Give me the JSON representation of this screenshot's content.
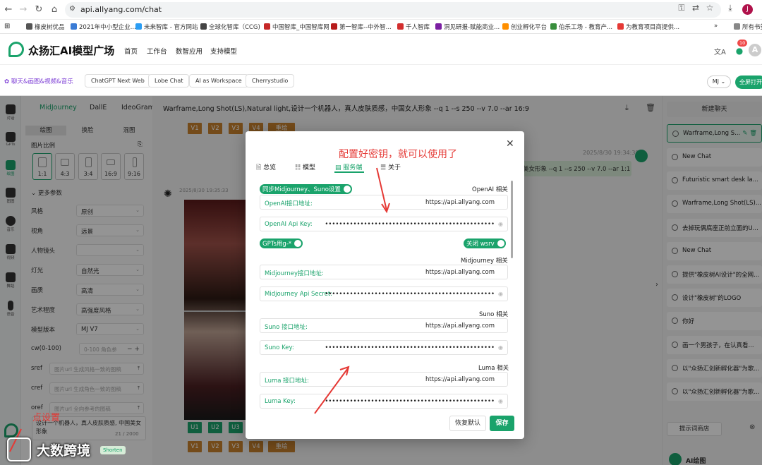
{
  "browser": {
    "url": "api.allyang.com/chat",
    "bookmarks": [
      "橡皮树优品",
      "2021年中小型企业...",
      "未来智库 - 官方网站",
      "全球化智库（CCG)",
      "中国智库_中国智库网",
      "第一智库--中外智...",
      "千人智库",
      "洞见研报-赋能商业...",
      "创业孵化平台",
      "伯乐工场 - 教育产...",
      "为教育项目商提供..."
    ],
    "bookmarks_more": "»",
    "all_bookmarks": "所有书签",
    "avatar_letter": "J"
  },
  "app": {
    "brand": "众扬汇AI模型广场",
    "nav": [
      "首页",
      "工作台",
      "数智应用",
      "支持模型"
    ],
    "notification_count": "10",
    "user_letter": "A"
  },
  "tabs": {
    "active": "聊天&画图&视频&音乐",
    "items": [
      "ChatGPT Next Web",
      "Lobe Chat",
      "AI as Workspace",
      "Cherrystudio"
    ],
    "model_select": "MJ",
    "full_open": "全屏打开"
  },
  "rail": [
    {
      "label": "对话",
      "icon": "chat-icon"
    },
    {
      "label": "GPTs",
      "icon": "gpts-icon"
    },
    {
      "label": "绘图",
      "icon": "palette-icon",
      "active": true
    },
    {
      "label": "图图",
      "icon": "image-icon"
    },
    {
      "label": "音乐",
      "icon": "music-icon"
    },
    {
      "label": "视频",
      "icon": "video-icon"
    },
    {
      "label": "舞蹈",
      "icon": "dance-icon"
    },
    {
      "label": "语音",
      "icon": "mic-icon"
    }
  ],
  "params": {
    "model_tabs": [
      "MidJourney",
      "DallE",
      "IdeoGram"
    ],
    "sub_tabs": [
      "绘图",
      "换脸",
      "混图"
    ],
    "ratio_label": "图片比例",
    "ratios": [
      "1:1",
      "4:3",
      "3:4",
      "16:9",
      "9:16"
    ],
    "more_params": "更多参数",
    "rows": [
      {
        "label": "风格",
        "value": "原创"
      },
      {
        "label": "视角",
        "value": "远景"
      },
      {
        "label": "人物镜头",
        "value": ""
      },
      {
        "label": "灯光",
        "value": "自然光"
      },
      {
        "label": "画质",
        "value": "高清"
      },
      {
        "label": "艺术程度",
        "value": "高强度风格"
      },
      {
        "label": "模型版本",
        "value": "MJ V7"
      }
    ],
    "cw_label": "cw(0-100)",
    "cw_placeholder": "0-100 角色参",
    "sref_label": "sref",
    "sref_placeholder": "图片url 生成风格一致的图稿",
    "cref_label": "cref",
    "cref_placeholder": "图片url 生成角色一致的图稿",
    "oref_label": "oref",
    "oref_placeholder": "图片url 全向参考的图稿",
    "prompt": "设计一个机器人，真人皮肤质感, 中国美女形象",
    "prompt_count": "21 / 2000",
    "shorten": "Shorten"
  },
  "chat": {
    "title": "Warframe,Long Shot(LS),Natural light,设计一个机器人，真人皮肤质感，中国女人形象 --q 1 --s 250 --v 7.0 --ar 16:9",
    "v_buttons": [
      "V1",
      "V2",
      "V3",
      "V4"
    ],
    "u_buttons": [
      "U1",
      "U2",
      "U3"
    ],
    "redraw": "重绘",
    "user_time": "2025/8/30 19:34:39",
    "user_msg": "美女形象 --q 1 --s 250 --v 7.0 --ar 1:1",
    "bot_time": "2025/8/30 19:35:33"
  },
  "history": {
    "new_chat": "新建聊天",
    "items": [
      "Warframe,Long S...",
      "New Chat",
      "Futuristic smart desk la...",
      "Warframe,Long Shot(LS)...",
      "去掉玩偶底座正前立面的U...",
      "New Chat",
      "提供\"橡皮树AI设计\"的全网...",
      "设计\"橡皮树\"的LOGO",
      "你好",
      "画一个男孩子，在认真看...",
      "以\"众扬汇创新孵化器\"为歌...",
      "以\"众扬汇创新孵化器\"为歌..."
    ],
    "prompt_store": "提示词商店",
    "ai_draw": "AI绘图"
  },
  "modal": {
    "tabs": [
      "总览",
      "模型",
      "服务端",
      "关于"
    ],
    "active_tab": "服务端",
    "sync_toggle": "同步Midjourney、Suno设置",
    "openai_section": "OpenAI 相关",
    "openai_url_label": "OpenAI接口地址:",
    "openai_url": "https://api.allyang.com",
    "openai_key_label": "OpenAI Api Key:",
    "masked": "••••••••••••••••••••••••••••••••••••••••••••••••",
    "gpts_toggle": "GPTs用g-*",
    "wsrv_toggle": "关闭 wsrv",
    "mj_section": "Midjourney 相关",
    "mj_url_label": "Midjourney接口地址:",
    "mj_url": "https://api.allyang.com",
    "mj_secret_label": "Midjourney Api Secret:",
    "suno_section": "Suno 相关",
    "suno_url_label": "Suno 接口地址:",
    "suno_url": "https://api.allyang.com",
    "suno_key_label": "Suno Key:",
    "luma_section": "Luma 相关",
    "luma_url_label": "Luma 接口地址:",
    "luma_url": "https://api.allyang.com",
    "luma_key_label": "Luma Key:",
    "reset": "恢复默认",
    "save": "保存"
  },
  "annotations": {
    "top": "配置好密钥，就可以使用了",
    "bottom": "点设置",
    "watermark": "大数跨境"
  },
  "colors": {
    "accent": "#1aa36b",
    "annotation": "#e53935",
    "redraw": "#c8812d",
    "purple": "#7e3fd6"
  }
}
